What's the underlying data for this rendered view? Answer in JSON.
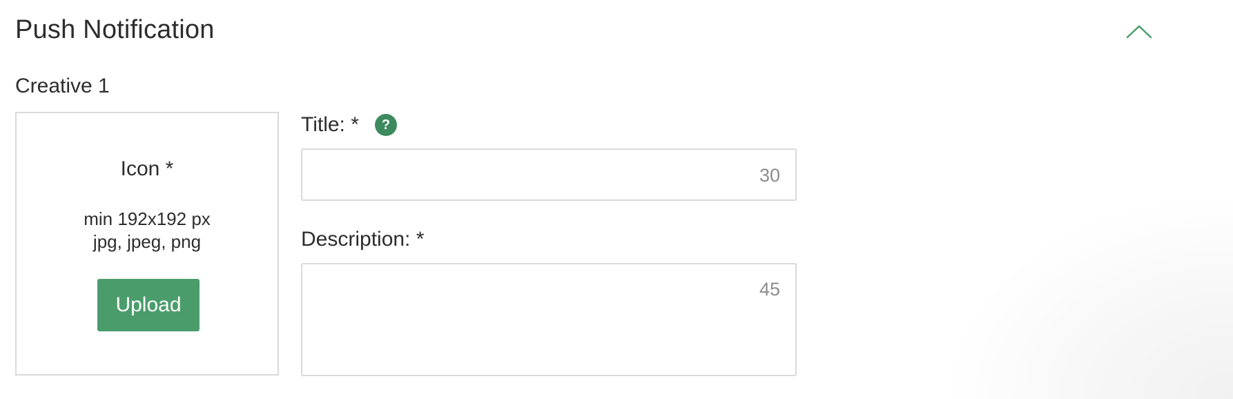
{
  "section": {
    "title": "Push Notification",
    "collapse_icon": "chevron-up-icon",
    "accent_color": "#4a9d6b"
  },
  "creative": {
    "title": "Creative 1",
    "icon_upload": {
      "label": "Icon *",
      "requirement_size": "min 192x192 px",
      "requirement_formats": "jpg, jpeg, png",
      "upload_label": "Upload"
    },
    "title_field": {
      "label": "Title: *",
      "help_icon": "question-mark-icon",
      "help_glyph": "?",
      "value": "",
      "counter": "30"
    },
    "description_field": {
      "label": "Description: *",
      "value": "",
      "counter": "45"
    }
  }
}
